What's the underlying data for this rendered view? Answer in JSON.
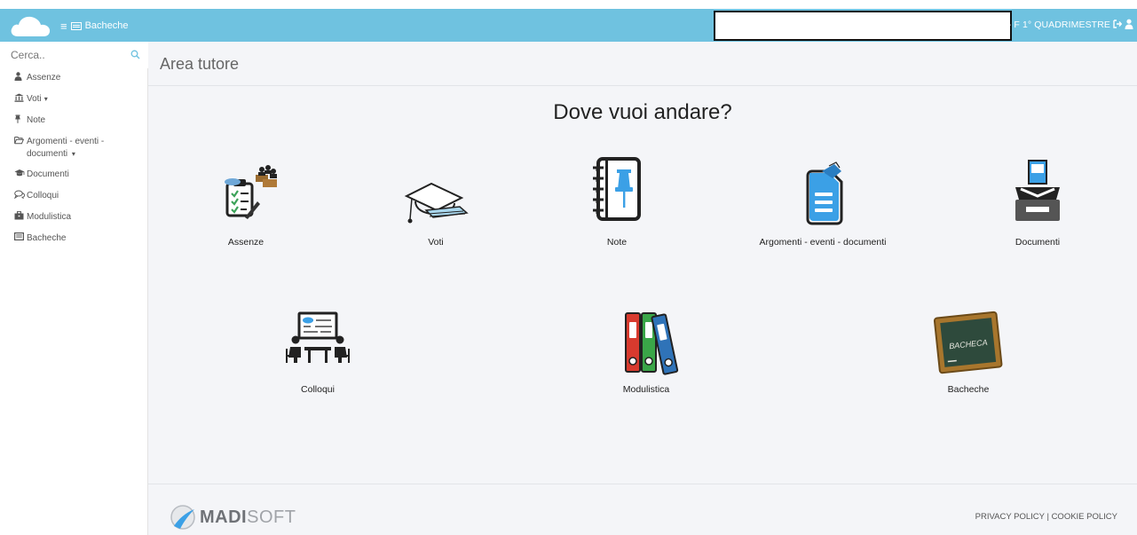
{
  "topbar": {
    "menu_label": "Bacheche",
    "period": "- F  1° QUADRIMESTRE",
    "bg_color": "#6fc2e0"
  },
  "sidebar": {
    "search_placeholder": "Cerca..",
    "items": [
      {
        "label": "Assenze",
        "icon": "user-icon"
      },
      {
        "label": "Voti",
        "icon": "bank-icon",
        "caret": "▾"
      },
      {
        "label": "Note",
        "icon": "pin-icon"
      },
      {
        "label": "Argomenti - eventi -",
        "label2": "documenti",
        "icon": "folder-open-icon",
        "caret": "▾"
      },
      {
        "label": "Documenti",
        "icon": "graduation-cap-icon"
      },
      {
        "label": "Colloqui",
        "icon": "comments-icon"
      },
      {
        "label": "Modulistica",
        "icon": "briefcase-icon"
      },
      {
        "label": "Bacheche",
        "icon": "board-icon"
      }
    ]
  },
  "main": {
    "header_title": "Area tutore",
    "question": "Dove vuoi andare?",
    "tiles": [
      {
        "label": "Assenze",
        "icon": "attendance-icon"
      },
      {
        "label": "Voti",
        "icon": "graduation-cap-icon"
      },
      {
        "label": "Note",
        "icon": "notebook-pin-icon"
      },
      {
        "label": "Argomenti - eventi - documenti",
        "icon": "document-icon"
      },
      {
        "label": "Documenti",
        "icon": "inbox-tray-icon"
      },
      {
        "label": "Colloqui",
        "icon": "meeting-icon"
      },
      {
        "label": "Modulistica",
        "icon": "binders-icon"
      },
      {
        "label": "Bacheche",
        "icon": "blackboard-icon",
        "board_text": "BACHECA"
      }
    ]
  },
  "footer": {
    "brand_bold": "MADI",
    "brand_light": "SOFT",
    "privacy": "PRIVACY POLICY",
    "separator": "|",
    "cookie": "COOKIE POLICY"
  }
}
